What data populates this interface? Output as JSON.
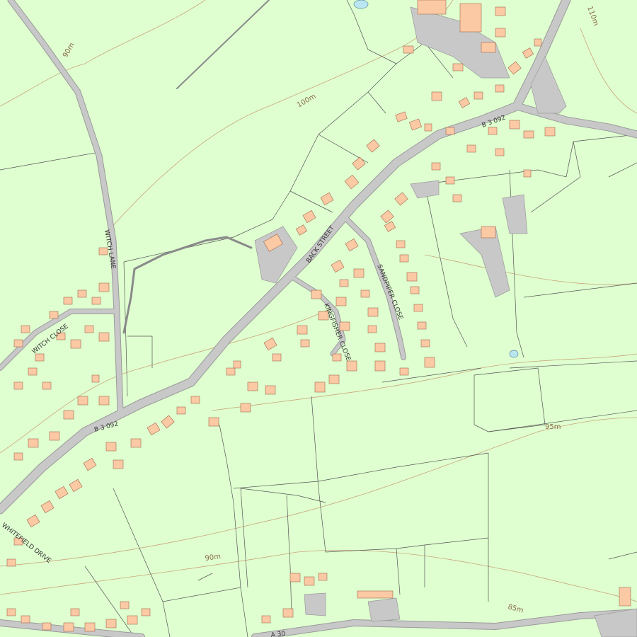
{
  "map": {
    "colors": {
      "background": "#dfffd0",
      "building": "#fcc9a5",
      "building_stroke": "#a06a4a",
      "road": "#c8c8c8",
      "road_stroke": "#9a9a9a",
      "boundary": "#555555",
      "contour": "#c9a57a",
      "water": "#b9e6f0"
    },
    "street_labels": {
      "witch_lane": "WITCH LANE",
      "witch_close": "WITCH CLOSE",
      "back_street": "BACK STREET",
      "sandpiper_close": "SANDPIPER CLOSE",
      "kingfisher_close": "KINGFISHER CLOSE",
      "whitefield_drive": "WHITEFIELD DRIVE",
      "b3092_west": "B 3 092",
      "b3092_east": "B 3 092",
      "a30": "A 30"
    },
    "contour_labels": {
      "c90_top": "90m",
      "c100": "100m",
      "c110": "110m",
      "c95": "95m",
      "c90_bottom": "90m",
      "c85": "85m"
    }
  }
}
